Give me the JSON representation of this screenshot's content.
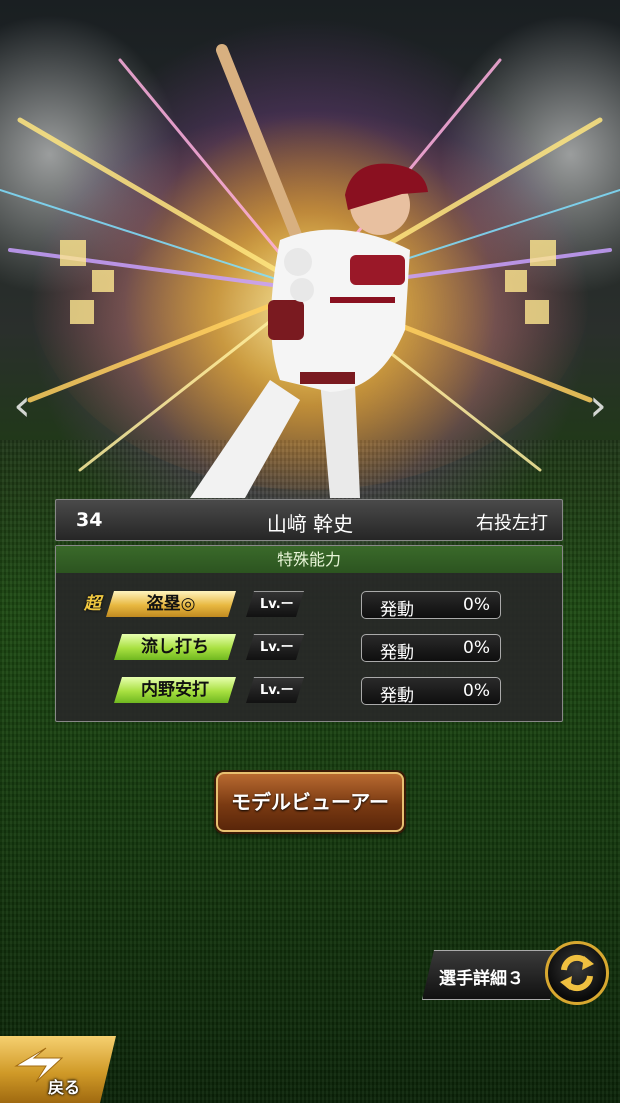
{
  "player": {
    "number": "34",
    "name": "山﨑 幹史",
    "throw_bat": "右投左打"
  },
  "abilities": {
    "header": "特殊能力",
    "items": [
      {
        "prefix": "超",
        "name": "盗塁◎",
        "level": "Lv.ー",
        "stat_label": "発動",
        "stat_value": "0%",
        "tier": "gold"
      },
      {
        "prefix": "",
        "name": "流し打ち",
        "level": "Lv.ー",
        "stat_label": "発動",
        "stat_value": "0%",
        "tier": "green"
      },
      {
        "prefix": "",
        "name": "内野安打",
        "level": "Lv.ー",
        "stat_label": "発動",
        "stat_value": "0%",
        "tier": "green"
      }
    ]
  },
  "buttons": {
    "model_viewer": "モデルビューアー",
    "player_detail": "選手詳細３",
    "back": "戻る"
  },
  "nav": {
    "prev": "‹",
    "next": "›"
  },
  "colors": {
    "ability_header": "#2c5420",
    "gold_pill": "#e8b840",
    "green_pill": "#a8e040",
    "button_brown": "#7a3a12",
    "uniform_red": "#8a1020"
  }
}
